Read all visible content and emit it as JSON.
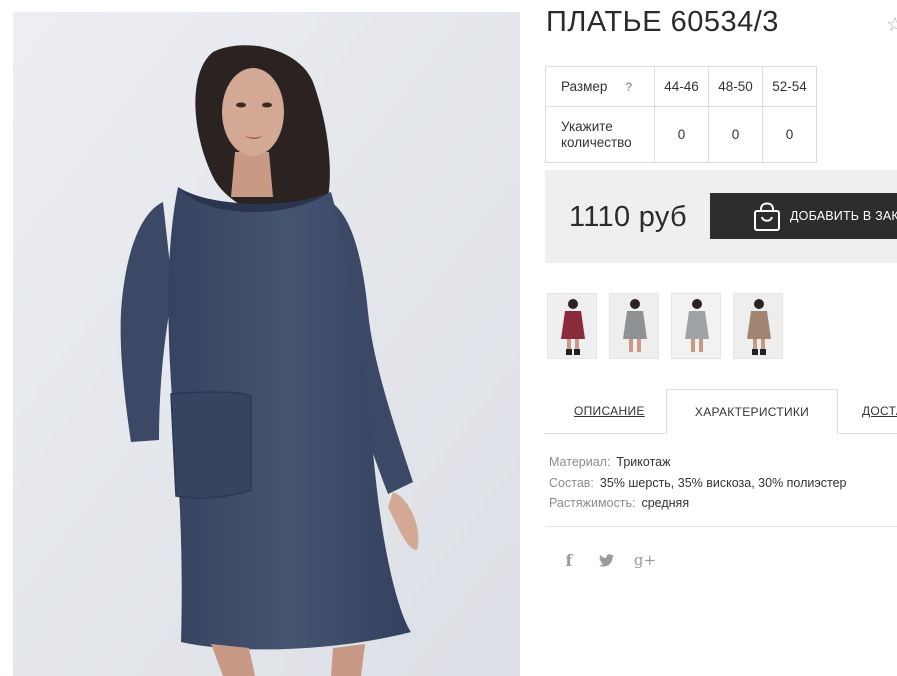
{
  "product": {
    "title": "ПЛАТЬЕ 60534/3",
    "favorite_icon": "star-outline-icon"
  },
  "sizes": {
    "header_label": "Размер",
    "help_glyph": "?",
    "columns": [
      "44-46",
      "48-50",
      "52-54"
    ],
    "quantity_label_line1": "Укажите",
    "quantity_label_line2": "количество",
    "quantities": [
      "0",
      "0",
      "0"
    ]
  },
  "purchase": {
    "price": "1110 руб",
    "add_to_cart_label": "ДОБАВИТЬ В ЗАКАЗ",
    "add_icon": "shopping-bag-icon"
  },
  "variants": [
    {
      "name": "burgundy",
      "color": "#8a2a3a"
    },
    {
      "name": "grey-melange",
      "color": "#8e9294"
    },
    {
      "name": "light-grey",
      "color": "#9fa3a6"
    },
    {
      "name": "beige",
      "color": "#a08572"
    }
  ],
  "tabs": [
    {
      "label": "ОПИСАНИЕ"
    },
    {
      "label": "ХАРАКТЕРИСТИКИ"
    },
    {
      "label": "ДОСТАВКА"
    }
  ],
  "characteristics": [
    {
      "key": "Материал:",
      "value": "Трикотаж"
    },
    {
      "key": "Состав:",
      "value": "35% шерсть, 35% вискоза, 30% полиэстер"
    },
    {
      "key": "Растяжимость:",
      "value": "средняя"
    }
  ],
  "social": {
    "facebook": "f",
    "twitter_icon": "twitter-bird-icon",
    "google_plus": "g+"
  },
  "colors": {
    "dress": "#3f4d6b",
    "button": "#2d2d2d",
    "price_bg": "#efefef",
    "photo_bg": "#e3e5ea"
  }
}
